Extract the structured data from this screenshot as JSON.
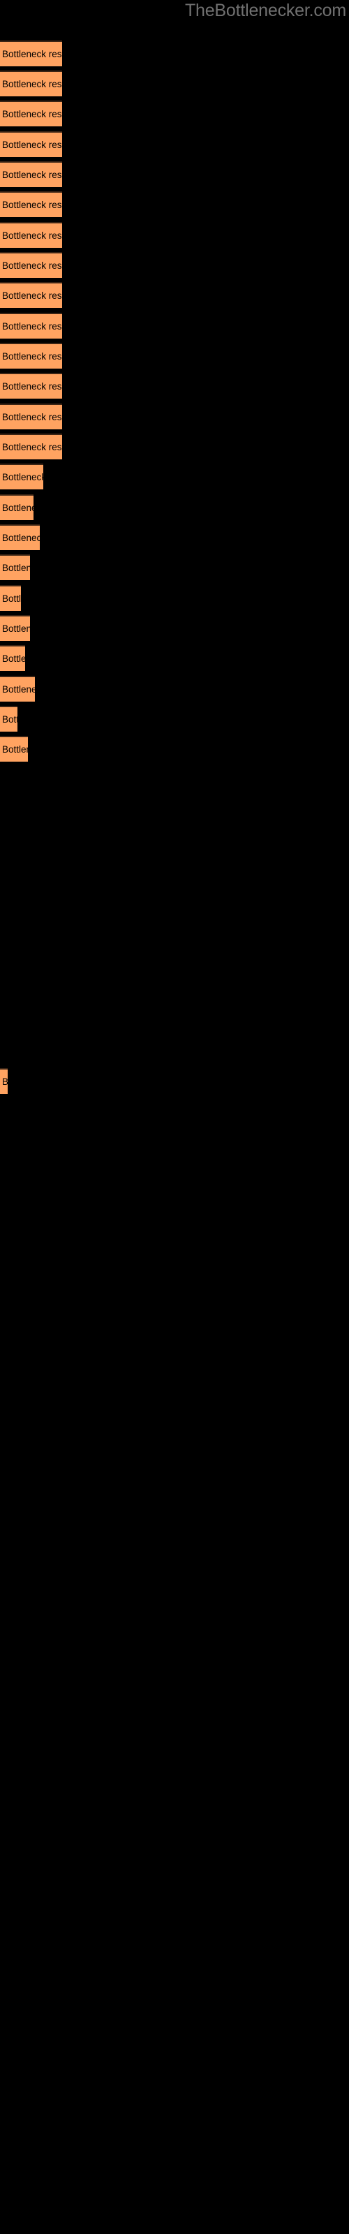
{
  "header": {
    "site_title": "TheBottlenecker.com"
  },
  "colors": {
    "background": "#000000",
    "bar_fill": "#ffa361",
    "bar_border": "#3a2415",
    "label_text": "#000000",
    "title_text": "#707070"
  },
  "chart_data": {
    "type": "bar",
    "orientation": "horizontal",
    "title": "TheBottlenecker.com",
    "xlabel": "",
    "ylabel": "",
    "grid": false,
    "legend": false,
    "bar_label_text": "Bottleneck result",
    "categories": [
      "Bottleneck result",
      "Bottleneck result",
      "Bottleneck result",
      "Bottleneck result",
      "Bottleneck result",
      "Bottleneck result",
      "Bottleneck result",
      "Bottleneck result",
      "Bottleneck result",
      "Bottleneck result",
      "Bottleneck result",
      "Bottleneck result",
      "Bottleneck result",
      "Bottleneck result",
      "Bottleneck result",
      "Bottleneck result",
      "Bottleneck result",
      "Bottleneck result",
      "Bottleneck result",
      "Bottleneck result",
      "Bottleneck result",
      "Bottleneck result",
      "Bottleneck result",
      "Bottleneck result",
      "Bottleneck result"
    ],
    "values": [
      89,
      89,
      89,
      89,
      89,
      89,
      89,
      89,
      89,
      89,
      89,
      89,
      89,
      89,
      62,
      48,
      57,
      43,
      30,
      43,
      36,
      50,
      25,
      40,
      11
    ],
    "xlim": [
      0,
      500
    ]
  },
  "bars": [
    {
      "label": "Bottleneck result",
      "width": 89,
      "top": 58
    },
    {
      "label": "Bottleneck result",
      "width": 89,
      "top": 101
    },
    {
      "label": "Bottleneck result",
      "width": 89,
      "top": 144
    },
    {
      "label": "Bottleneck result",
      "width": 89,
      "top": 188
    },
    {
      "label": "Bottleneck result",
      "width": 89,
      "top": 231
    },
    {
      "label": "Bottleneck result",
      "width": 89,
      "top": 274
    },
    {
      "label": "Bottleneck result",
      "width": 89,
      "top": 318
    },
    {
      "label": "Bottleneck result",
      "width": 89,
      "top": 361
    },
    {
      "label": "Bottleneck result",
      "width": 89,
      "top": 404
    },
    {
      "label": "Bottleneck result",
      "width": 89,
      "top": 448
    },
    {
      "label": "Bottleneck result",
      "width": 89,
      "top": 491
    },
    {
      "label": "Bottleneck result",
      "width": 89,
      "top": 534
    },
    {
      "label": "Bottleneck result",
      "width": 89,
      "top": 578
    },
    {
      "label": "Bottleneck result",
      "width": 89,
      "top": 621
    },
    {
      "label": "Bottleneck result",
      "width": 62,
      "top": 664
    },
    {
      "label": "Bottleneck result",
      "width": 48,
      "top": 708
    },
    {
      "label": "Bottleneck result",
      "width": 57,
      "top": 751
    },
    {
      "label": "Bottleneck result",
      "width": 43,
      "top": 794
    },
    {
      "label": "Bottleneck result",
      "width": 30,
      "top": 838
    },
    {
      "label": "Bottleneck result",
      "width": 43,
      "top": 881
    },
    {
      "label": "Bottleneck result",
      "width": 36,
      "top": 924
    },
    {
      "label": "Bottleneck result",
      "width": 50,
      "top": 968
    },
    {
      "label": "Bottleneck result",
      "width": 25,
      "top": 1011
    },
    {
      "label": "Bottleneck result",
      "width": 40,
      "top": 1054
    },
    {
      "label": "Bottleneck result",
      "width": 11,
      "top": 1530
    }
  ]
}
